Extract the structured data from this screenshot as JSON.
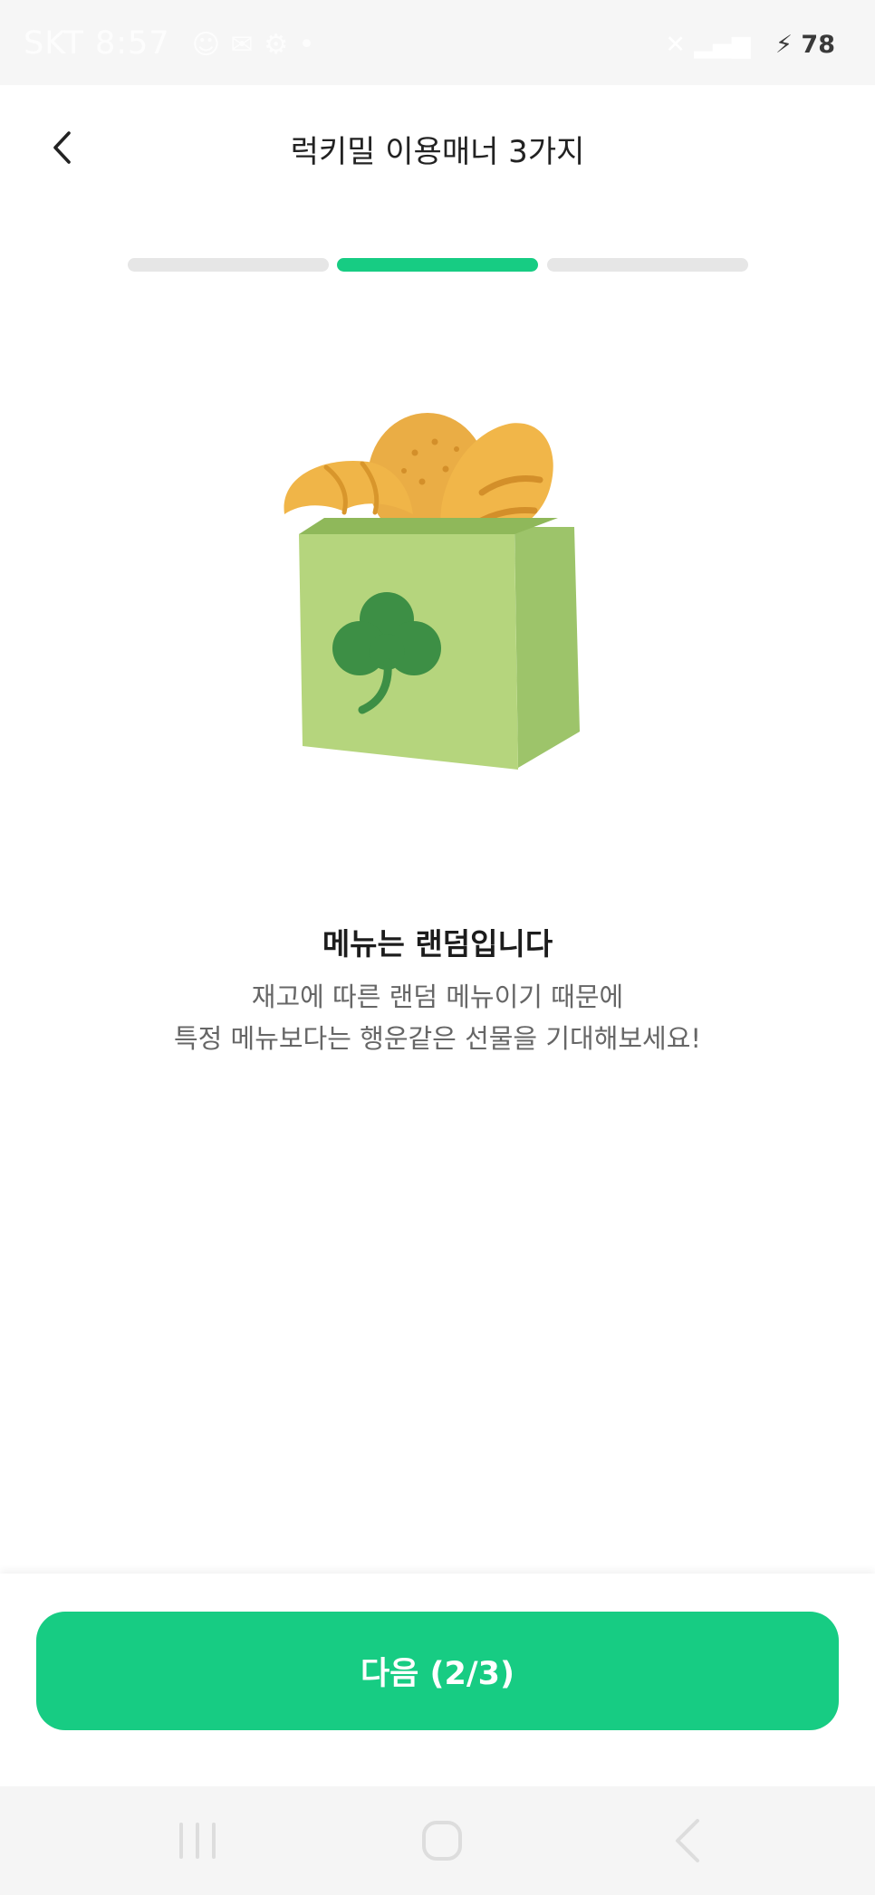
{
  "status_bar": {
    "carrier": "SKT",
    "time": "8:57",
    "battery": "78"
  },
  "header": {
    "title": "럭키밀 이용매너 3가지",
    "back_icon": "chevron-left-icon"
  },
  "progress": {
    "current_step": 2,
    "total_steps": 3,
    "active_color": "#17cc83",
    "inactive_color": "#e6e6e6"
  },
  "illustration": {
    "icon": "bread-bag-clover-icon"
  },
  "content": {
    "headline": "메뉴는 랜덤입니다",
    "description_line1": "재고에 따른 랜덤 메뉴이기 때문에",
    "description_line2": "특정 메뉴보다는 행운같은 선물을 기대해보세요!"
  },
  "next_button": {
    "label": "다음 (2/3)",
    "color": "#17cc83"
  },
  "nav_bar": {
    "recents_icon": "recent-apps-icon",
    "home_icon": "home-icon",
    "back_icon": "back-nav-icon"
  }
}
